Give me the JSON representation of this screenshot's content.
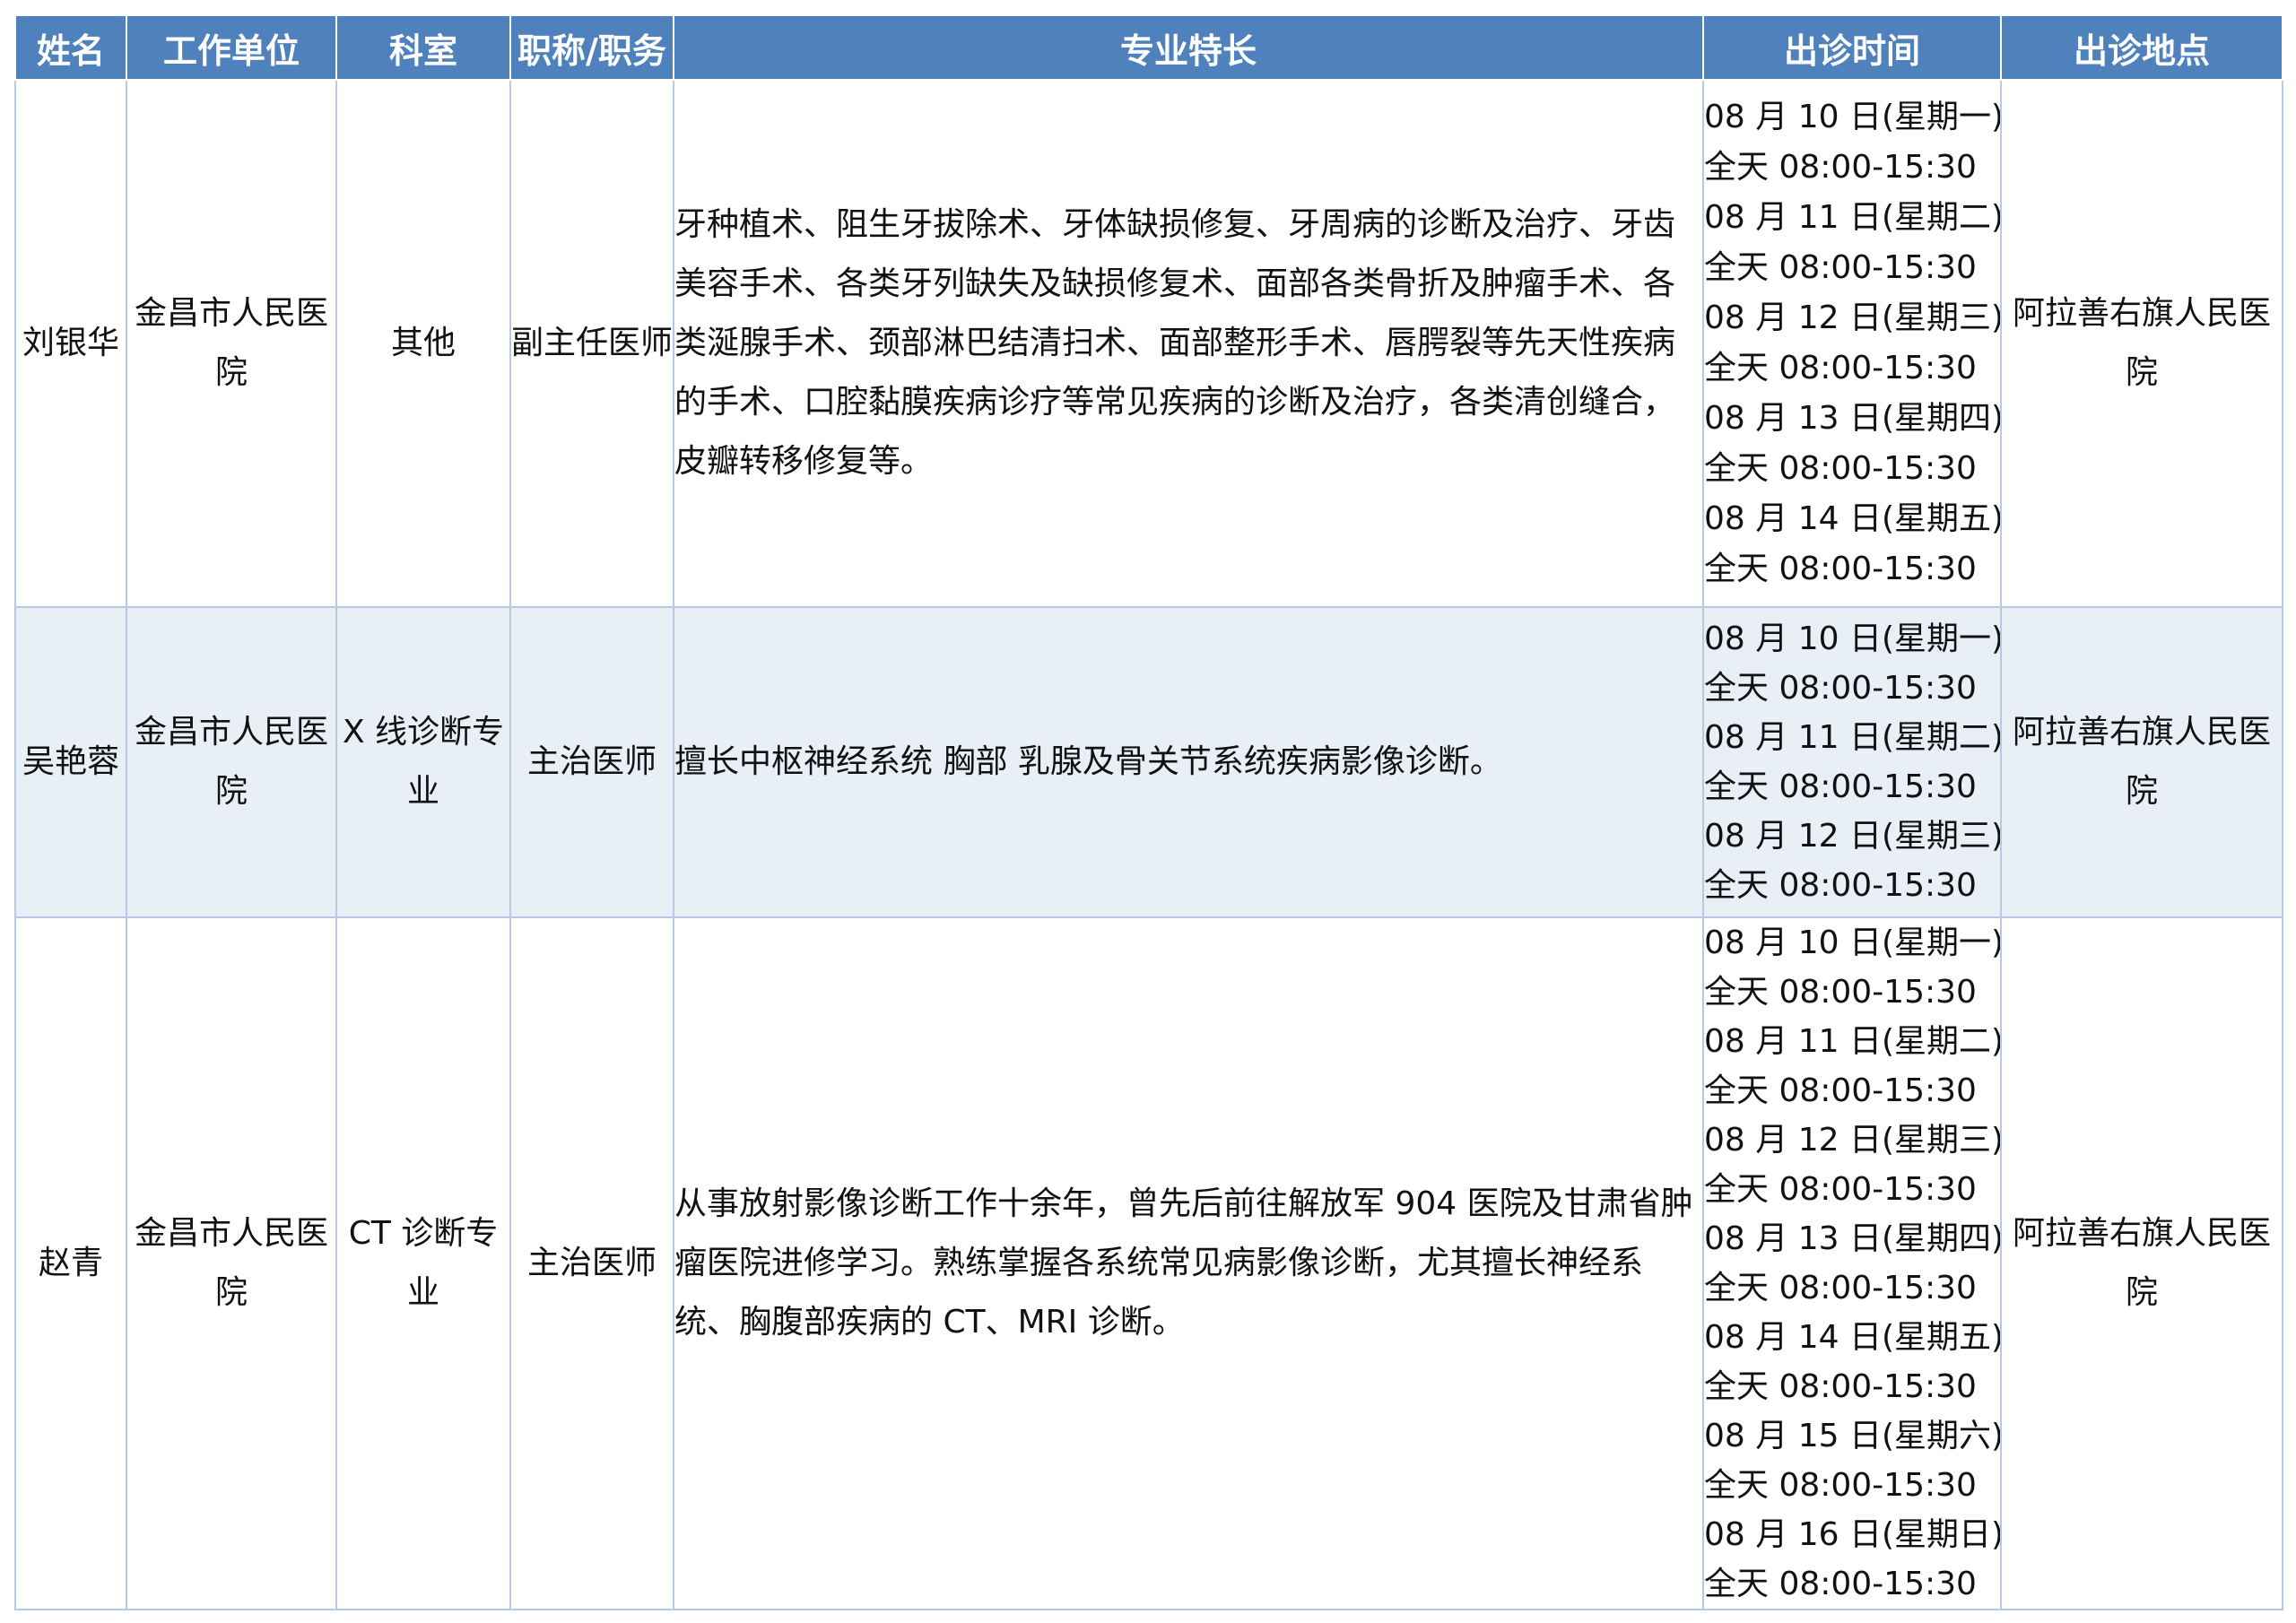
{
  "header": {
    "name": "姓名",
    "unit": "工作单位",
    "dept": "科室",
    "title": "职称/职务",
    "specialty": "专业特长",
    "time": "出诊时间",
    "location": "出诊地点"
  },
  "rows": [
    {
      "name": "刘银华",
      "unit": "金昌市人民医院",
      "dept": "其他",
      "title": "副主任医师",
      "specialty": "牙种植术、阻生牙拔除术、牙体缺损修复、牙周病的诊断及治疗、牙齿美容手术、各类牙列缺失及缺损修复术、面部各类骨折及肿瘤手术、各类涎腺手术、颈部淋巴结清扫术、面部整形手术、唇腭裂等先天性疾病的手术、口腔黏膜疾病诊疗等常见疾病的诊断及治疗，各类清创缝合，皮瓣转移修复等。",
      "schedule": [
        "08 月 10 日(星期一)",
        "全天 08:00-15:30",
        "08 月 11 日(星期二)",
        "全天 08:00-15:30",
        "08 月 12 日(星期三)",
        "全天 08:00-15:30",
        "08 月 13 日(星期四)",
        "全天 08:00-15:30",
        "08 月 14 日(星期五)",
        "全天 08:00-15:30"
      ],
      "location": "阿拉善右旗人民医院"
    },
    {
      "name": "吴艳蓉",
      "unit": "金昌市人民医院",
      "dept": "X 线诊断专业",
      "title": "主治医师",
      "specialty": "擅长中枢神经系统 胸部 乳腺及骨关节系统疾病影像诊断。",
      "schedule": [
        "08 月 10 日(星期一)",
        "全天 08:00-15:30",
        "08 月 11 日(星期二)",
        "全天 08:00-15:30",
        "08 月 12 日(星期三)",
        "全天 08:00-15:30"
      ],
      "location": "阿拉善右旗人民医院"
    },
    {
      "name": "赵青",
      "unit": "金昌市人民医院",
      "dept": "CT 诊断专业",
      "title": "主治医师",
      "specialty": "从事放射影像诊断工作十余年，曾先后前往解放军 904 医院及甘肃省肿瘤医院进修学习。熟练掌握各系统常见病影像诊断，尤其擅长神经系统、胸腹部疾病的 CT、MRI 诊断。",
      "schedule": [
        "08 月 10 日(星期一)",
        "全天 08:00-15:30",
        "08 月 11 日(星期二)",
        "全天 08:00-15:30",
        "08 月 12 日(星期三)",
        "全天 08:00-15:30",
        "08 月 13 日(星期四)",
        "全天 08:00-15:30",
        "08 月 14 日(星期五)",
        "全天 08:00-15:30",
        "08 月 15 日(星期六)",
        "全天 08:00-15:30",
        "08 月 16 日(星期日)",
        "全天 08:00-15:30"
      ],
      "location": "阿拉善右旗人民医院"
    }
  ]
}
